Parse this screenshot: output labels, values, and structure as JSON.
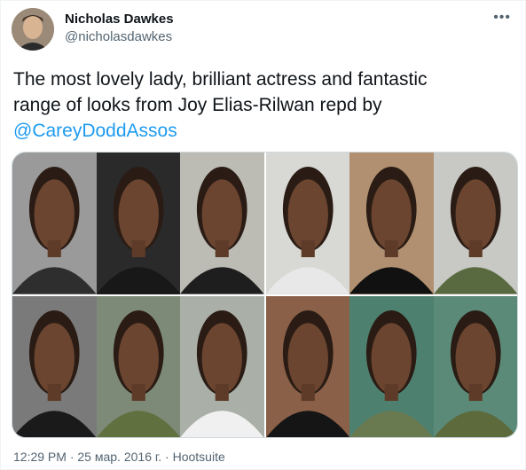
{
  "author": {
    "name": "Nicholas Dawkes",
    "handle": "@nicholasdawkes",
    "avatar_icon": "avatar-photo"
  },
  "more_icon": "more-icon",
  "tweet": {
    "text_line1": "The most lovely lady, brilliant actress and fantastic",
    "text_line2": "range of looks from Joy  Elias-Rilwan repd by",
    "mention": "@CareyDoddAssos"
  },
  "photos": [
    {
      "name": "photo-1",
      "bg": "#9a9a9a",
      "top": "#2e2e2e"
    },
    {
      "name": "photo-2",
      "bg": "#2a2a2a",
      "top": "#181818"
    },
    {
      "name": "photo-3",
      "bg": "#bcbcb4",
      "top": "#1e1e1e"
    },
    {
      "name": "photo-4",
      "bg": "#d8d8d4",
      "top": "#e8e8e8"
    },
    {
      "name": "photo-5",
      "bg": "#b09070",
      "top": "#111111"
    },
    {
      "name": "photo-6",
      "bg": "#c8c8c4",
      "top": "#5a6a40"
    },
    {
      "name": "photo-7",
      "bg": "#7a7a7a",
      "top": "#1a1a1a"
    },
    {
      "name": "photo-8",
      "bg": "#7e8a78",
      "top": "#60703f"
    },
    {
      "name": "photo-9",
      "bg": "#aab0a8",
      "top": "#f0f0f0"
    },
    {
      "name": "photo-10",
      "bg": "#8a6048",
      "top": "#151515"
    },
    {
      "name": "photo-11",
      "bg": "#4e8070",
      "top": "#6a7a50"
    },
    {
      "name": "photo-12",
      "bg": "#5b8a78",
      "top": "#5c6a3c"
    }
  ],
  "meta": {
    "time": "12:29 PM",
    "sep1": " · ",
    "date": "25 мар. 2016 г.",
    "sep2": " · ",
    "source": "Hootsuite"
  },
  "colors": {
    "accent": "#1d9bf0",
    "secondary_text": "#536471"
  }
}
